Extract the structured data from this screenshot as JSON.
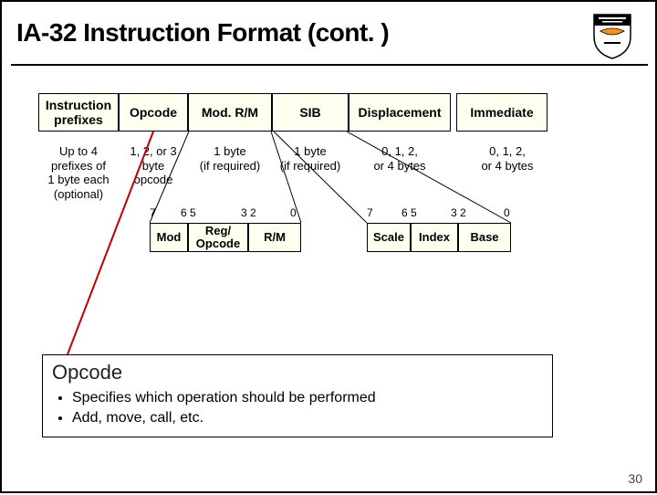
{
  "title": "IA-32 Instruction Format (cont. )",
  "page_number": "30",
  "format_boxes": {
    "prefixes": "Instruction\nprefixes",
    "opcode": "Opcode",
    "modrm": "Mod. R/M",
    "sib": "SIB",
    "displacement": "Displacement",
    "immediate": "Immediate"
  },
  "sizes": {
    "prefixes": "Up to 4\nprefixes of\n1 byte each\n(optional)",
    "opcode": "1, 2, or 3 byte\nopcode",
    "modrm": "1 byte\n(if required)",
    "sib": "1 byte\n(if required)",
    "displacement": "0, 1, 2,\nor 4 bytes",
    "immediate": "0, 1, 2,\nor 4 bytes"
  },
  "bits": {
    "b7": "7",
    "b65": "6 5",
    "b32": "3 2",
    "b0": "0"
  },
  "modrm_sub": {
    "mod": "Mod",
    "reg": "Reg/\nOpcode",
    "rm": "R/M"
  },
  "sib_sub": {
    "scale": "Scale",
    "index": "Index",
    "base": "Base"
  },
  "opcode_section": {
    "heading": "Opcode",
    "b1": "Specifies which operation should be performed",
    "b2": "Add, move, call, etc."
  }
}
